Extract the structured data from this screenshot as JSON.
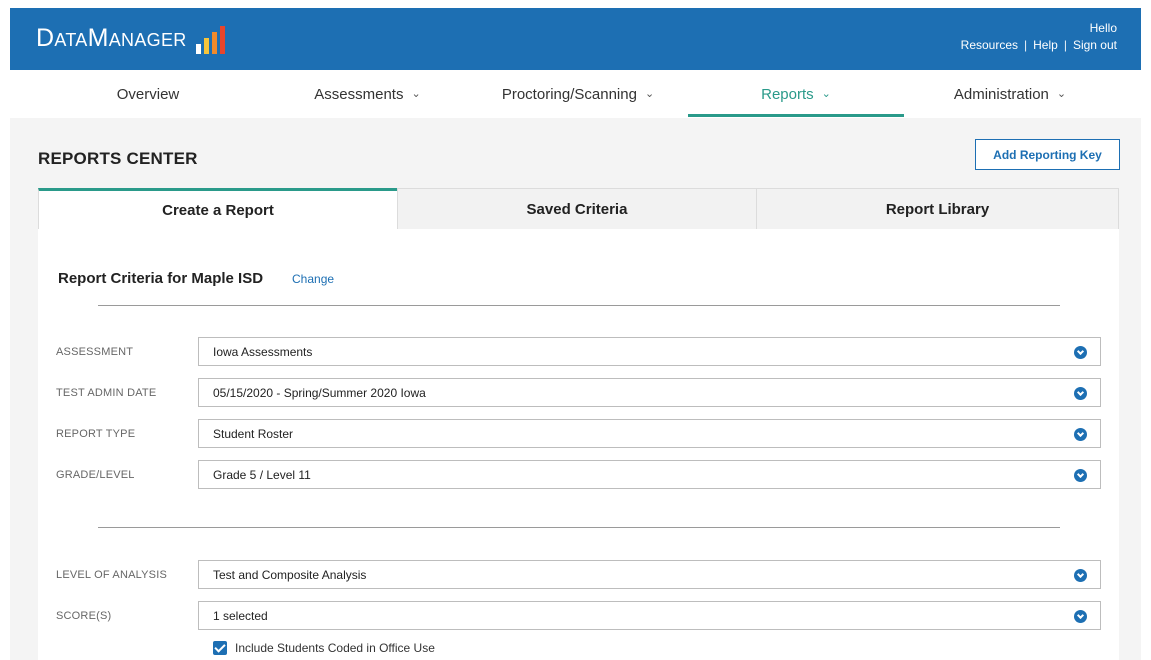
{
  "header": {
    "logo": {
      "part1_big": "D",
      "part1_small": "ATA",
      "part2_big": "M",
      "part2_small": "ANAGER"
    },
    "greeting": "Hello",
    "links": [
      "Resources",
      "Help",
      "Sign out"
    ],
    "separator": "|"
  },
  "nav": {
    "items": [
      {
        "label": "Overview",
        "has_chevron": false
      },
      {
        "label": "Assessments",
        "has_chevron": true
      },
      {
        "label": "Proctoring/Scanning",
        "has_chevron": true
      },
      {
        "label": "Reports",
        "has_chevron": true,
        "active": true
      },
      {
        "label": "Administration",
        "has_chevron": true
      }
    ],
    "chevron": "⌄"
  },
  "page": {
    "title": "REPORTS CENTER",
    "add_key_button": "Add Reporting Key"
  },
  "tabs": [
    {
      "label": "Create a Report",
      "active": true
    },
    {
      "label": "Saved Criteria",
      "active": false
    },
    {
      "label": "Report Library",
      "active": false
    }
  ],
  "criteria": {
    "title": "Report Criteria for Maple ISD",
    "change_link": "Change",
    "fields": [
      {
        "label": "ASSESSMENT",
        "value": "Iowa Assessments"
      },
      {
        "label": "TEST ADMIN DATE",
        "value": "05/15/2020 - Spring/Summer 2020 Iowa"
      },
      {
        "label": "REPORT TYPE",
        "value": "Student Roster"
      },
      {
        "label": "GRADE/LEVEL",
        "value": "Grade 5 / Level 11"
      },
      {
        "label": "LEVEL OF ANALYSIS",
        "value": "Test and Composite Analysis"
      },
      {
        "label": "SCORE(S)",
        "value": "1 selected"
      }
    ],
    "include_checkbox": {
      "label": "Include Students Coded in Office Use",
      "checked": true
    }
  },
  "colors": {
    "brand_blue": "#1d6fb3",
    "accent_teal": "#2a9a8a",
    "logo_bars": [
      "#ffffff",
      "#f6c53b",
      "#f08a2c",
      "#e8452c"
    ]
  }
}
